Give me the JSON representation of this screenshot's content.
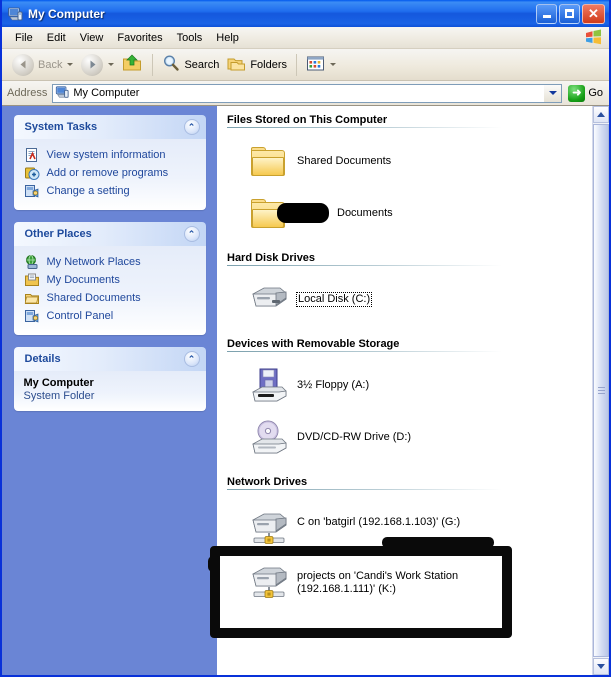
{
  "window": {
    "title": "My Computer",
    "title_icon": "my-computer-icon",
    "buttons": {
      "minimize": "_",
      "maximize": "□",
      "close": "✕"
    }
  },
  "menubar": {
    "items": [
      "File",
      "Edit",
      "View",
      "Favorites",
      "Tools",
      "Help"
    ],
    "logo": "windows-flag-icon"
  },
  "toolbar": {
    "back": {
      "label": "Back",
      "icon": "back-arrow-icon",
      "disabled": true
    },
    "forward": {
      "label": "",
      "icon": "forward-arrow-icon"
    },
    "up": {
      "label": "",
      "icon": "up-folder-icon"
    },
    "search": {
      "label": "Search",
      "icon": "search-icon"
    },
    "folders": {
      "label": "Folders",
      "icon": "folders-icon"
    },
    "views": {
      "label": "",
      "icon": "views-icon"
    }
  },
  "addressbar": {
    "label": "Address",
    "value": "My Computer",
    "icon": "my-computer-icon",
    "go_label": "Go",
    "go_icon": "green-arrow-icon"
  },
  "sidebar": {
    "panels": [
      {
        "title": "System Tasks",
        "collapse_icon": "chevron-up-icon",
        "items": [
          {
            "label": "View system information",
            "icon": "system-info-icon"
          },
          {
            "label": "Add or remove programs",
            "icon": "add-remove-programs-icon"
          },
          {
            "label": "Change a setting",
            "icon": "control-panel-icon"
          }
        ]
      },
      {
        "title": "Other Places",
        "collapse_icon": "chevron-up-icon",
        "items": [
          {
            "label": "My Network Places",
            "icon": "network-places-icon"
          },
          {
            "label": "My Documents",
            "icon": "my-documents-icon"
          },
          {
            "label": "Shared Documents",
            "icon": "shared-documents-icon"
          },
          {
            "label": "Control Panel",
            "icon": "control-panel-icon"
          }
        ]
      }
    ],
    "details": {
      "title": "Details",
      "collapse_icon": "chevron-up-icon",
      "name": "My Computer",
      "type": "System Folder"
    }
  },
  "content": {
    "sections": [
      {
        "heading": "Files Stored on This Computer",
        "items": [
          {
            "label": "Shared Documents",
            "icon": "folder-icon",
            "redacted": false,
            "focused": false
          },
          {
            "label": "Documents",
            "icon": "folder-icon",
            "redacted": true,
            "focused": false
          }
        ]
      },
      {
        "heading": "Hard Disk Drives",
        "items": [
          {
            "label": "Local Disk (C:)",
            "icon": "hard-drive-icon",
            "redacted": false,
            "focused": true
          }
        ]
      },
      {
        "heading": "Devices with Removable Storage",
        "items": [
          {
            "label": "3½ Floppy (A:)",
            "icon": "floppy-drive-icon",
            "redacted": false,
            "focused": false
          },
          {
            "label": "DVD/CD-RW Drive (D:)",
            "icon": "optical-drive-icon",
            "redacted": false,
            "focused": false
          }
        ]
      },
      {
        "heading": "Network Drives",
        "items": [
          {
            "label": "C on 'batgirl (192.168.1.103)' (G:)",
            "icon": "network-drive-icon",
            "redacted": false,
            "focused": false
          },
          {
            "label": "projects on 'Candi's Work Station (192.168.1.111)' (K:)",
            "icon": "network-drive-icon",
            "redacted": false,
            "focused": false
          }
        ]
      }
    ]
  },
  "scrollbar": {
    "up_icon": "scroll-up-icon",
    "down_icon": "scroll-down-icon"
  },
  "annotations": {
    "highlight_rect": "hand-drawn-black-rectangle",
    "redaction_blob": "black-redaction-blob"
  },
  "colors": {
    "titlebar_blue": "#0058ee",
    "sidebar_blue": "#6a85d5",
    "panel_header_text": "#1e4a9c",
    "link_text": "#20489c",
    "annotation_black": "#0a0a0a",
    "go_green": "#17a017"
  }
}
